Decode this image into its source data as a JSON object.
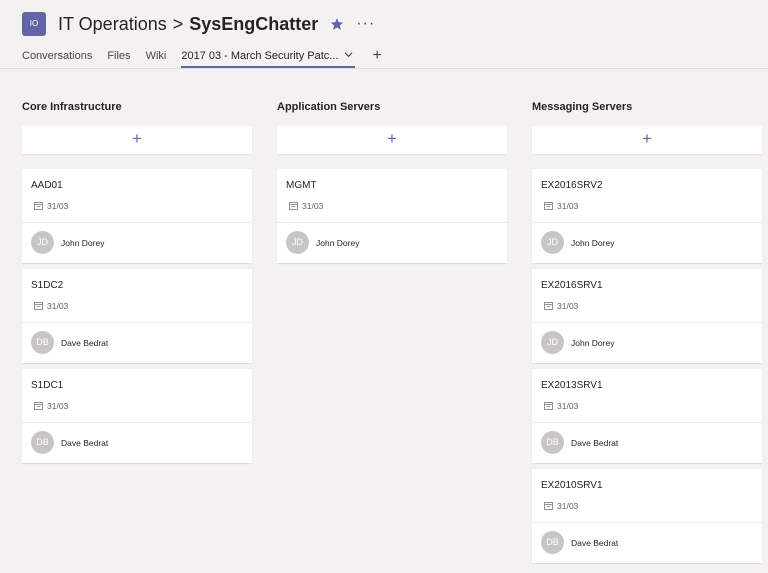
{
  "header": {
    "team_initials": "IO",
    "team_name": "IT Operations",
    "separator": ">",
    "channel_name": "SysEngChatter",
    "more_label": "···"
  },
  "tabs": [
    {
      "label": "Conversations"
    },
    {
      "label": "Files"
    },
    {
      "label": "Wiki"
    },
    {
      "label": "2017 03 - March Security Patc..."
    }
  ],
  "add_tab_label": "+",
  "add_task_label": "+",
  "buckets": [
    {
      "title": "Core Infrastructure",
      "tasks": [
        {
          "title": "AAD01",
          "due": "31/03",
          "initials": "JD",
          "assignee": "John Dorey"
        },
        {
          "title": "S1DC2",
          "due": "31/03",
          "initials": "DB",
          "assignee": "Dave Bedrat"
        },
        {
          "title": "S1DC1",
          "due": "31/03",
          "initials": "DB",
          "assignee": "Dave Bedrat"
        }
      ]
    },
    {
      "title": "Application Servers",
      "tasks": [
        {
          "title": "MGMT",
          "due": "31/03",
          "initials": "JD",
          "assignee": "John Dorey"
        }
      ]
    },
    {
      "title": "Messaging Servers",
      "tasks": [
        {
          "title": "EX2016SRV2",
          "due": "31/03",
          "initials": "JD",
          "assignee": "John Dorey"
        },
        {
          "title": "EX2016SRV1",
          "due": "31/03",
          "initials": "JD",
          "assignee": "John Dorey"
        },
        {
          "title": "EX2013SRV1",
          "due": "31/03",
          "initials": "DB",
          "assignee": "Dave Bedrat"
        },
        {
          "title": "EX2010SRV1",
          "due": "31/03",
          "initials": "DB",
          "assignee": "Dave Bedrat"
        }
      ]
    }
  ],
  "colors": {
    "accent": "#6264a7",
    "background": "#f3f2f1",
    "card": "#ffffff",
    "avatar": "#c8c6c4"
  },
  "icons": {
    "favorite": "star-icon",
    "more": "more-options-icon",
    "due": "calendar-icon",
    "tab_menu": "chevron-down-icon"
  }
}
